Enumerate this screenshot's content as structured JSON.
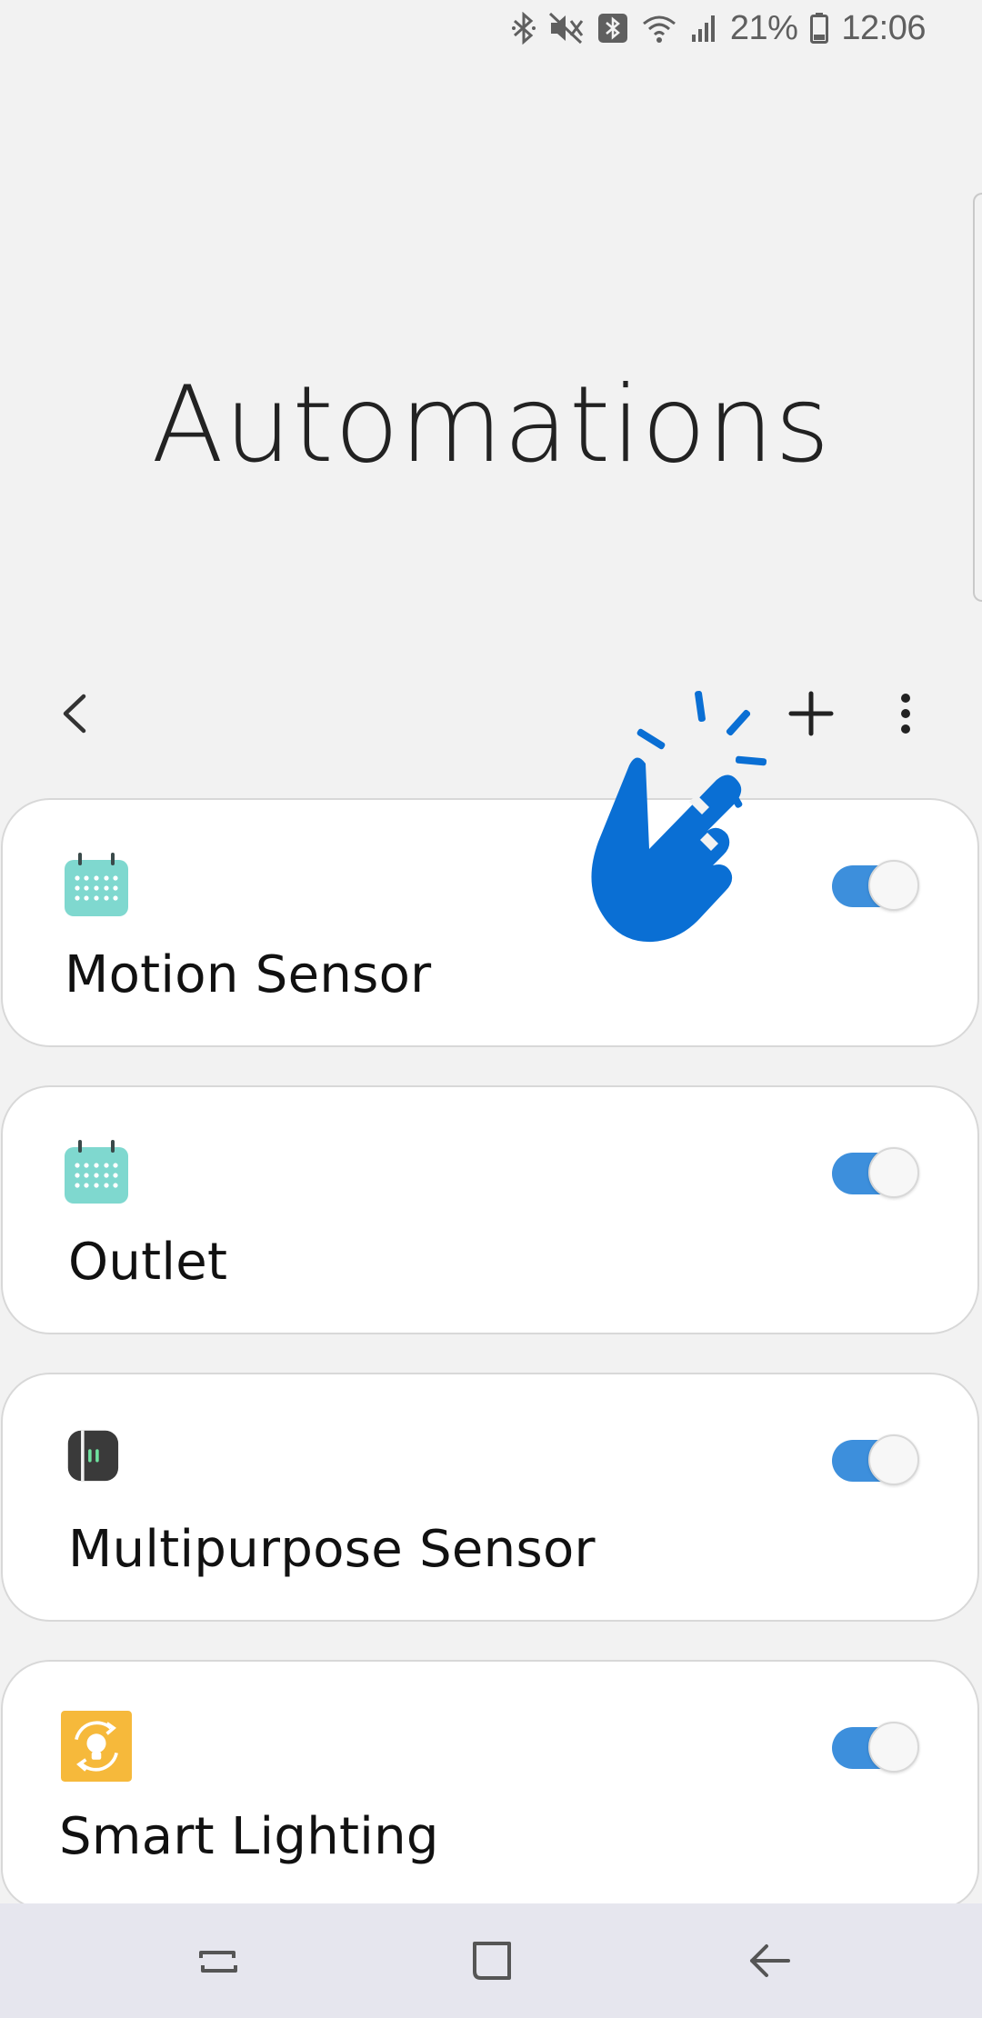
{
  "status_bar": {
    "battery_percent": "21%",
    "time": "12:06"
  },
  "header": {
    "title": "Automations"
  },
  "action_bar": {
    "back_icon": "chevron-left-icon",
    "add_icon": "plus-icon",
    "more_icon": "more-vertical-icon"
  },
  "automations": [
    {
      "label": "Motion Sensor",
      "icon": "calendar-icon",
      "enabled": true
    },
    {
      "label": "Outlet",
      "icon": "calendar-icon",
      "enabled": true
    },
    {
      "label": "Multipurpose Sensor",
      "icon": "multipurpose-sensor-icon",
      "enabled": true
    },
    {
      "label": "Smart Lighting",
      "icon": "smart-lighting-icon",
      "enabled": true
    }
  ],
  "colors": {
    "toggle_on": "#3d8fdc",
    "calendar_icon": "#7fd8cf",
    "lighting_icon": "#f6b93b",
    "sensor_icon": "#3a3a3a",
    "tap_hint": "#0a6fd4"
  },
  "nav_bar": {
    "recents_icon": "recent-apps-icon",
    "home_icon": "home-icon",
    "back_icon": "back-arrow-icon"
  }
}
